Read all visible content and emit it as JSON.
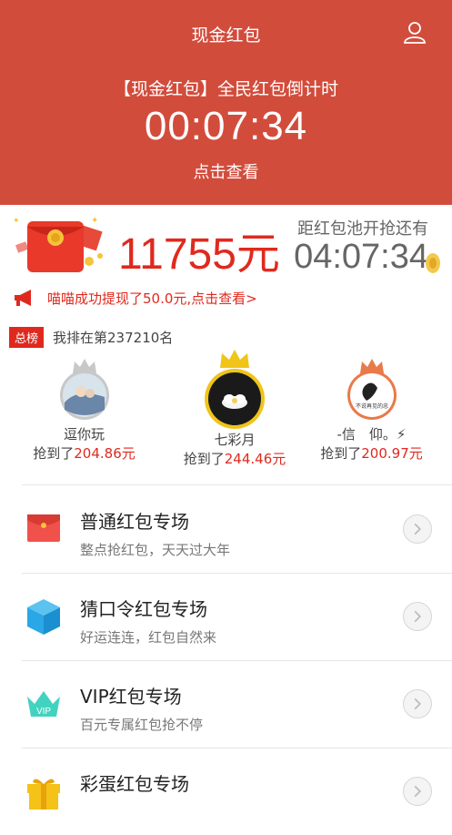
{
  "header": {
    "title": "现金红包",
    "countdown_label": "【现金红包】全民红包倒计时",
    "countdown_time": "00:07:34",
    "view_link": "点击查看"
  },
  "pool": {
    "amount": "11755元",
    "label": "距红包池开抢还有",
    "timer": "04:07:34"
  },
  "notice": {
    "text": "喵喵成功提现了50.0元,点击查看>"
  },
  "ranking": {
    "badge": "总榜",
    "my_rank_text": "我排在第237210名"
  },
  "winners": [
    {
      "name": "逗你玩",
      "prefix": "抢到了",
      "amount": "204.86元"
    },
    {
      "name": "七彩月",
      "prefix": "抢到了",
      "amount": "244.46元"
    },
    {
      "name": "-信　仰。⚡",
      "prefix": "抢到了",
      "amount": "200.97元"
    }
  ],
  "list": [
    {
      "title": "普通红包专场",
      "subtitle": "整点抢红包，天天过大年"
    },
    {
      "title": "猜口令红包专场",
      "subtitle": "好运连连，红包自然来"
    },
    {
      "title": "VIP红包专场",
      "subtitle": "百元专属红包抢不停"
    },
    {
      "title": "彩蛋红包专场",
      "subtitle": ""
    }
  ],
  "icon_text": {
    "vip": "VIP",
    "avatar3_caption": "不说再见的忠"
  },
  "colors": {
    "header_bg": "#d24c3c",
    "accent_red": "#e0291e",
    "gold": "#f0c419",
    "silver": "#c8c8c8",
    "bronze": "#e97a4a",
    "cube_blue": "#2aa7e6",
    "vip_teal": "#41d3c0"
  }
}
